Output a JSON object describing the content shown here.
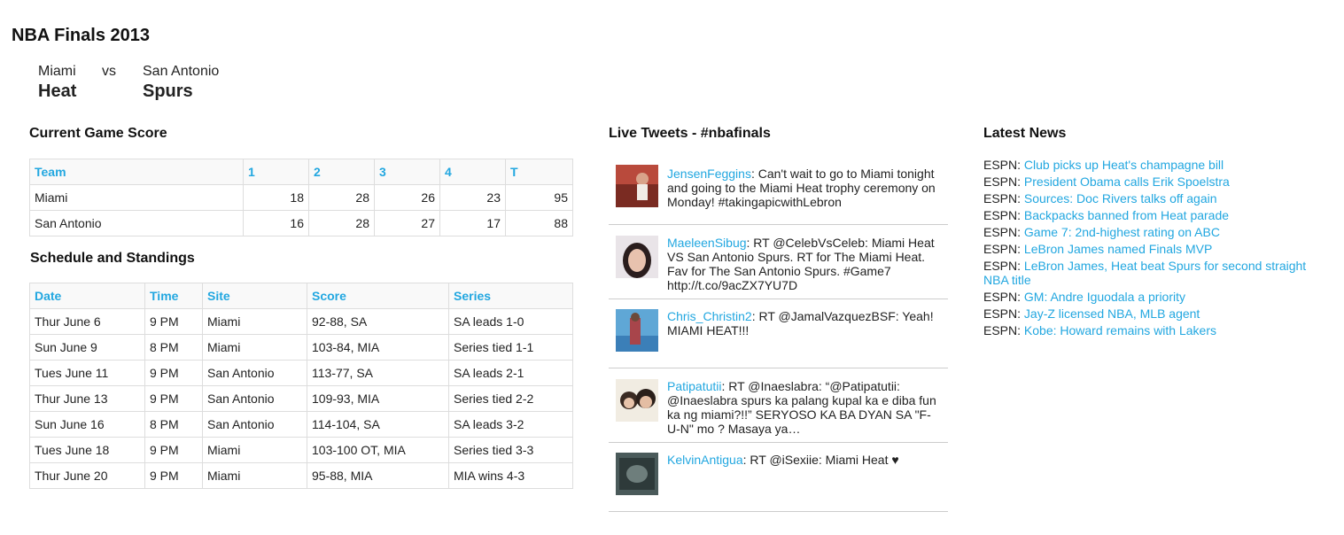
{
  "page_title": "NBA Finals 2013",
  "matchup": {
    "home": {
      "city": "Miami",
      "team": "Heat"
    },
    "vs": "vs",
    "away": {
      "city": "San Antonio",
      "team": "Spurs"
    }
  },
  "score": {
    "heading": "Current Game Score",
    "columns": [
      "Team",
      "1",
      "2",
      "3",
      "4",
      "T"
    ],
    "rows": [
      [
        "Miami",
        "18",
        "28",
        "26",
        "23",
        "95"
      ],
      [
        "San Antonio",
        "16",
        "28",
        "27",
        "17",
        "88"
      ]
    ]
  },
  "schedule": {
    "heading": "Schedule and Standings",
    "columns": [
      "Date",
      "Time",
      "Site",
      "Score",
      "Series"
    ],
    "rows": [
      [
        "Thur June 6",
        "9 PM",
        "Miami",
        "92-88, SA",
        "SA leads 1-0"
      ],
      [
        "Sun June 9",
        "8 PM",
        "Miami",
        "103-84, MIA",
        "Series tied 1-1"
      ],
      [
        "Tues June 11",
        "9 PM",
        "San Antonio",
        "113-77, SA",
        "SA leads 2-1"
      ],
      [
        "Thur June 13",
        "9 PM",
        "San Antonio",
        "109-93, MIA",
        "Series tied 2-2"
      ],
      [
        "Sun June 16",
        "8 PM",
        "San Antonio",
        "114-104, SA",
        "SA leads 3-2"
      ],
      [
        "Tues June 18",
        "9 PM",
        "Miami",
        "103-100 OT, MIA",
        "Series tied 3-3"
      ],
      [
        "Thur June 20",
        "9 PM",
        "Miami",
        "95-88, MIA",
        "MIA wins 4-3"
      ]
    ]
  },
  "tweets": {
    "heading": "Live Tweets - #nbafinals",
    "items": [
      {
        "user": "JensenFeggins",
        "text": ": Can't wait to go to Miami tonight and going to the Miami Heat trophy ceremony on Monday! #takingapicwithLebron"
      },
      {
        "user": "MaeleenSibug",
        "text": ": RT @CelebVsCeleb: Miami Heat VS San Antonio Spurs. RT for The Miami Heat. Fav for The San Antonio Spurs. #Game7 http://t.co/9acZX7YU7D"
      },
      {
        "user": "Chris_Christin2",
        "text": ": RT @JamalVazquezBSF: Yeah! MIAMI HEAT!!!"
      },
      {
        "user": "Patipatutii",
        "text": ": RT @Inaeslabra: “@Patipatutii: @Inaeslabra spurs ka palang kupal ka e diba fun ka ng miami?!!” SERYOSO KA BA DYAN SA \"F-U-N\" mo ? Masaya ya…"
      },
      {
        "user": "KelvinAntigua",
        "text": ": RT @iSexiie: Miami Heat ♥"
      }
    ]
  },
  "news": {
    "heading": "Latest News",
    "items": [
      {
        "source": "ESPN:",
        "title": "Club picks up Heat's champagne bill"
      },
      {
        "source": "ESPN:",
        "title": "President Obama calls Erik Spoelstra"
      },
      {
        "source": "ESPN:",
        "title": "Sources: Doc Rivers talks off again"
      },
      {
        "source": "ESPN:",
        "title": "Backpacks banned from Heat parade"
      },
      {
        "source": "ESPN:",
        "title": "Game 7: 2nd-highest rating on ABC"
      },
      {
        "source": "ESPN:",
        "title": "LeBron James named Finals MVP"
      },
      {
        "source": "ESPN:",
        "title": "LeBron James, Heat beat Spurs for second straight NBA title"
      },
      {
        "source": "ESPN:",
        "title": "GM: Andre Iguodala a priority"
      },
      {
        "source": "ESPN:",
        "title": "Jay-Z licensed NBA, MLB agent"
      },
      {
        "source": "ESPN:",
        "title": "Kobe: Howard remains with Lakers"
      }
    ]
  }
}
